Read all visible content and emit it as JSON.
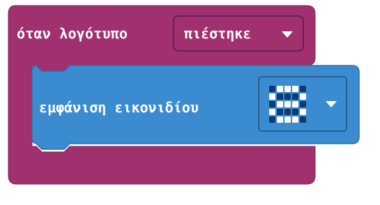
{
  "event_block": {
    "label": "όταν λογότυπο",
    "logo_dropdown_value": "πιέστηκε",
    "color": "#a1306f"
  },
  "command_block": {
    "label": "εμφάνιση εικονιδίου",
    "color": "#3b8bd0",
    "icon_dropdown": {
      "led_on_color": "#ffffff",
      "led_off_color": "#0a3c73",
      "pattern": [
        [
          0,
          1,
          1,
          1,
          0
        ],
        [
          1,
          0,
          0,
          0,
          1
        ],
        [
          0,
          1,
          1,
          1,
          0
        ],
        [
          1,
          0,
          0,
          0,
          1
        ],
        [
          0,
          1,
          1,
          1,
          0
        ]
      ]
    }
  },
  "icons": {
    "logo_dropdown_caret": "caret-down-icon",
    "icon_dropdown_caret": "caret-down-icon"
  }
}
